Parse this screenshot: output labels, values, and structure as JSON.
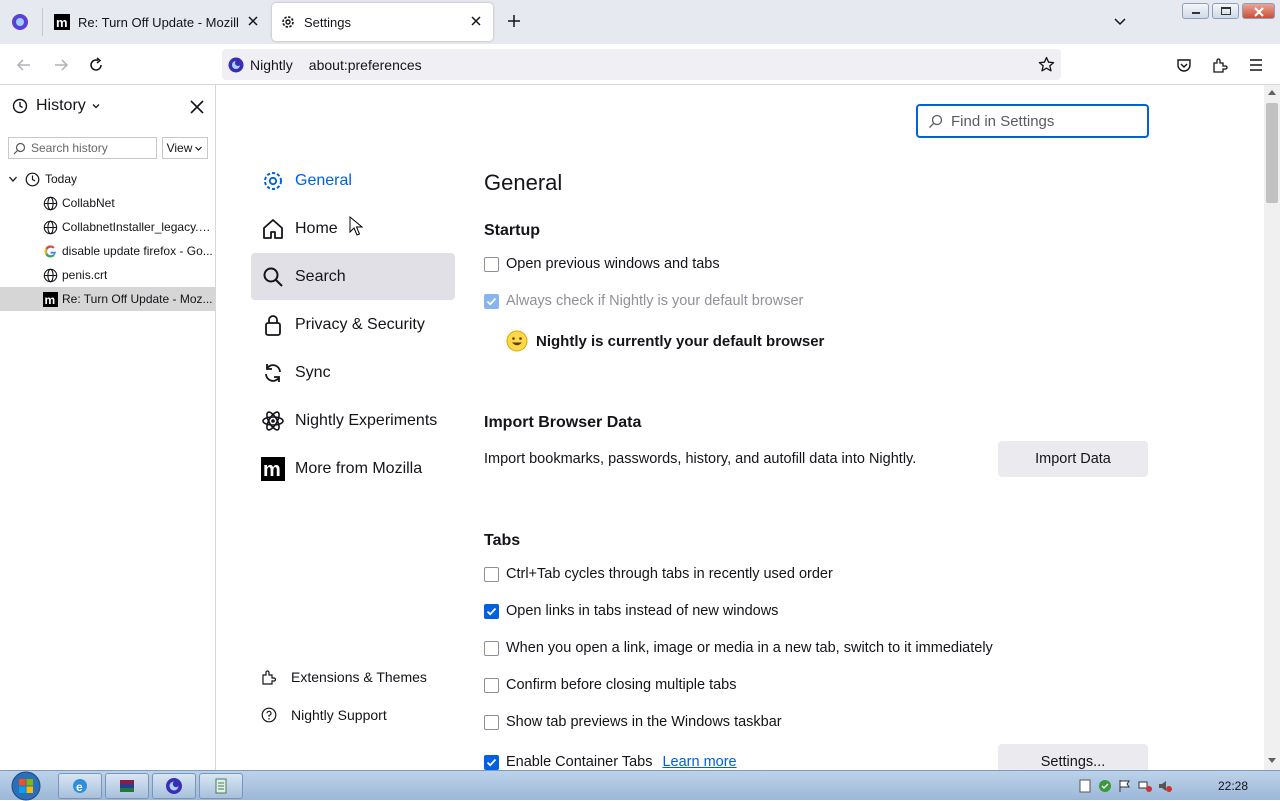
{
  "tabs": [
    {
      "title": "Re: Turn Off Update - Mozilla C",
      "favicon": "mozilla-m-icon"
    },
    {
      "title": "Settings",
      "favicon": "gear-icon"
    }
  ],
  "urlbar": {
    "identity": "Nightly",
    "url": "about:preferences"
  },
  "sidebar": {
    "title": "History",
    "search_placeholder": "Search history",
    "view_label": "View",
    "group": "Today",
    "items": [
      {
        "label": "CollabNet",
        "icon": "globe-icon"
      },
      {
        "label": "CollabnetInstaller_legacy.e...",
        "icon": "globe-icon"
      },
      {
        "label": "disable update firefox - Go...",
        "icon": "google-icon"
      },
      {
        "label": "penis.crt",
        "icon": "globe-icon"
      },
      {
        "label": "Re: Turn Off Update - Moz...",
        "icon": "mozilla-m-icon"
      }
    ]
  },
  "settings": {
    "find_placeholder": "Find in Settings",
    "categories": [
      "General",
      "Home",
      "Search",
      "Privacy & Security",
      "Sync",
      "Nightly Experiments",
      "More from Mozilla"
    ],
    "footer": [
      "Extensions & Themes",
      "Nightly Support"
    ],
    "page_title": "General",
    "startup": {
      "heading": "Startup",
      "open_previous": "Open previous windows and tabs",
      "always_check": "Always check if Nightly is your default browser",
      "default_status": "Nightly is currently your default browser"
    },
    "import": {
      "heading": "Import Browser Data",
      "description": "Import bookmarks, passwords, history, and autofill data into Nightly.",
      "button": "Import Data"
    },
    "tabs_section": {
      "heading": "Tabs",
      "options": [
        {
          "label": "Ctrl+Tab cycles through tabs in recently used order",
          "checked": false
        },
        {
          "label": "Open links in tabs instead of new windows",
          "checked": true
        },
        {
          "label": "When you open a link, image or media in a new tab, switch to it immediately",
          "checked": false
        },
        {
          "label": "Confirm before closing multiple tabs",
          "checked": false
        },
        {
          "label": "Show tab previews in the Windows taskbar",
          "checked": false
        },
        {
          "label": "Enable Container Tabs",
          "checked": true
        }
      ],
      "learn_more": "Learn more",
      "settings_button": "Settings..."
    }
  },
  "taskbar": {
    "clock": "22:28"
  },
  "colors": {
    "accent": "#0061e0"
  }
}
